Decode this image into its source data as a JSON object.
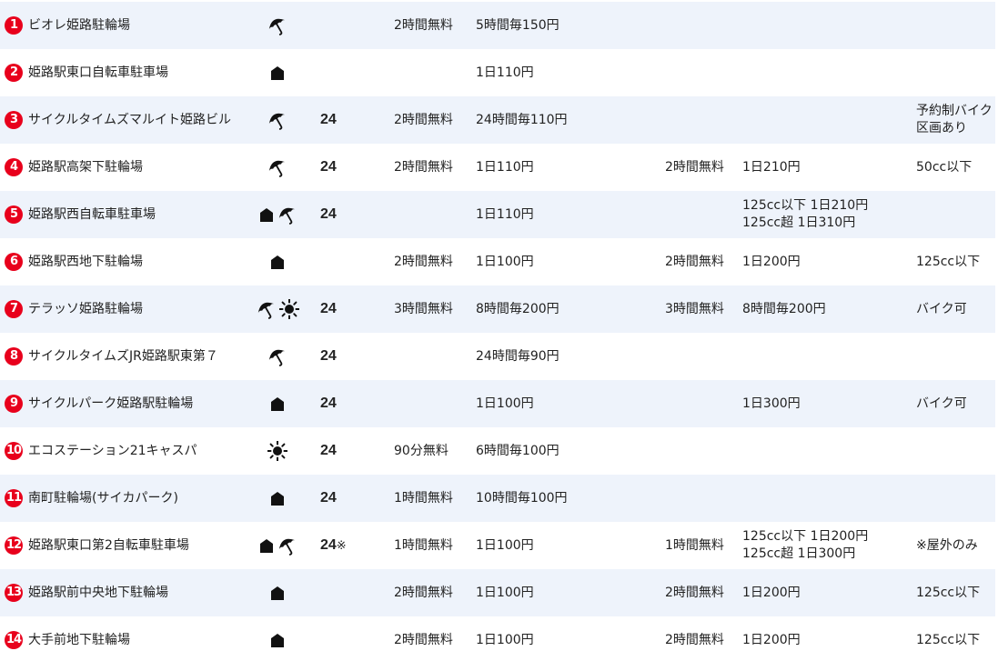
{
  "colors": {
    "number_badge": "#e8001c",
    "row_shade": "#eef3fb"
  },
  "rows": [
    {
      "num": "1",
      "name": "ビオレ姫路駐輪場",
      "icons": [
        "umbrella-icon"
      ],
      "h24": "",
      "h24_mark": "",
      "bike_free": "2時間無料",
      "bike_fee": [
        "5時間毎150円"
      ],
      "moto_free": "",
      "moto_fee": [],
      "note": []
    },
    {
      "num": "2",
      "name": "姫路駅東口自転車駐車場",
      "icons": [
        "roof-icon"
      ],
      "h24": "",
      "h24_mark": "",
      "bike_free": "",
      "bike_fee": [
        "1日110円"
      ],
      "moto_free": "",
      "moto_fee": [],
      "note": []
    },
    {
      "num": "3",
      "name": "サイクルタイムズマルイト姫路ビル",
      "icons": [
        "umbrella-icon"
      ],
      "h24": "24",
      "h24_mark": "",
      "bike_free": "2時間無料",
      "bike_fee": [
        "24時間毎110円"
      ],
      "moto_free": "",
      "moto_fee": [],
      "note": [
        "予約制バイク",
        "区画あり"
      ]
    },
    {
      "num": "4",
      "name": "姫路駅高架下駐輪場",
      "icons": [
        "umbrella-icon"
      ],
      "h24": "24",
      "h24_mark": "",
      "bike_free": "2時間無料",
      "bike_fee": [
        "1日110円"
      ],
      "moto_free": "2時間無料",
      "moto_fee": [
        "1日210円"
      ],
      "note": [
        "50cc以下"
      ]
    },
    {
      "num": "5",
      "name": "姫路駅西自転車駐車場",
      "icons": [
        "roof-icon",
        "umbrella-icon"
      ],
      "h24": "24",
      "h24_mark": "",
      "bike_free": "",
      "bike_fee": [
        "1日110円"
      ],
      "moto_free": "",
      "moto_fee": [
        "125cc以下 1日210円",
        "125cc超 1日310円"
      ],
      "note": []
    },
    {
      "num": "6",
      "name": "姫路駅西地下駐輪場",
      "icons": [
        "roof-icon"
      ],
      "h24": "",
      "h24_mark": "",
      "bike_free": "2時間無料",
      "bike_fee": [
        "1日100円"
      ],
      "moto_free": "2時間無料",
      "moto_fee": [
        "1日200円"
      ],
      "note": [
        "125cc以下"
      ]
    },
    {
      "num": "7",
      "name": "テラッソ姫路駐輪場",
      "icons": [
        "umbrella-icon",
        "sun-icon"
      ],
      "h24": "24",
      "h24_mark": "",
      "bike_free": "3時間無料",
      "bike_fee": [
        "8時間毎200円"
      ],
      "moto_free": "3時間無料",
      "moto_fee": [
        "8時間毎200円"
      ],
      "note": [
        "バイク可"
      ]
    },
    {
      "num": "8",
      "name": "サイクルタイムズJR姫路駅東第７",
      "icons": [
        "umbrella-icon"
      ],
      "h24": "24",
      "h24_mark": "",
      "bike_free": "",
      "bike_fee": [
        "24時間毎90円"
      ],
      "moto_free": "",
      "moto_fee": [],
      "note": []
    },
    {
      "num": "9",
      "name": "サイクルパーク姫路駅駐輪場",
      "icons": [
        "roof-icon"
      ],
      "h24": "24",
      "h24_mark": "",
      "bike_free": "",
      "bike_fee": [
        "1日100円"
      ],
      "moto_free": "",
      "moto_fee": [
        "1日300円"
      ],
      "note": [
        "バイク可"
      ]
    },
    {
      "num": "10",
      "name": "エコステーション21キャスパ",
      "icons": [
        "sun-icon"
      ],
      "h24": "24",
      "h24_mark": "",
      "bike_free": "90分無料",
      "bike_fee": [
        "6時間毎100円"
      ],
      "moto_free": "",
      "moto_fee": [],
      "note": []
    },
    {
      "num": "11",
      "name": "南町駐輪場(サイカパーク)",
      "icons": [
        "roof-icon"
      ],
      "h24": "24",
      "h24_mark": "",
      "bike_free": "1時間無料",
      "bike_fee": [
        "10時間毎100円"
      ],
      "moto_free": "",
      "moto_fee": [],
      "note": []
    },
    {
      "num": "12",
      "name": "姫路駅東口第2自転車駐車場",
      "icons": [
        "roof-icon",
        "umbrella-icon"
      ],
      "h24": "24",
      "h24_mark": "※",
      "bike_free": "1時間無料",
      "bike_fee": [
        "1日100円"
      ],
      "moto_free": "1時間無料",
      "moto_fee": [
        "125cc以下 1日200円",
        "125cc超 1日300円"
      ],
      "note": [
        "※屋外のみ"
      ]
    },
    {
      "num": "13",
      "name": "姫路駅前中央地下駐輪場",
      "icons": [
        "roof-icon"
      ],
      "h24": "",
      "h24_mark": "",
      "bike_free": "2時間無料",
      "bike_fee": [
        "1日100円"
      ],
      "moto_free": "2時間無料",
      "moto_fee": [
        "1日200円"
      ],
      "note": [
        "125cc以下"
      ]
    },
    {
      "num": "14",
      "name": "大手前地下駐輪場",
      "icons": [
        "roof-icon"
      ],
      "h24": "",
      "h24_mark": "",
      "bike_free": "2時間無料",
      "bike_fee": [
        "1日100円"
      ],
      "moto_free": "2時間無料",
      "moto_fee": [
        "1日200円"
      ],
      "note": [
        "125cc以下"
      ]
    }
  ]
}
